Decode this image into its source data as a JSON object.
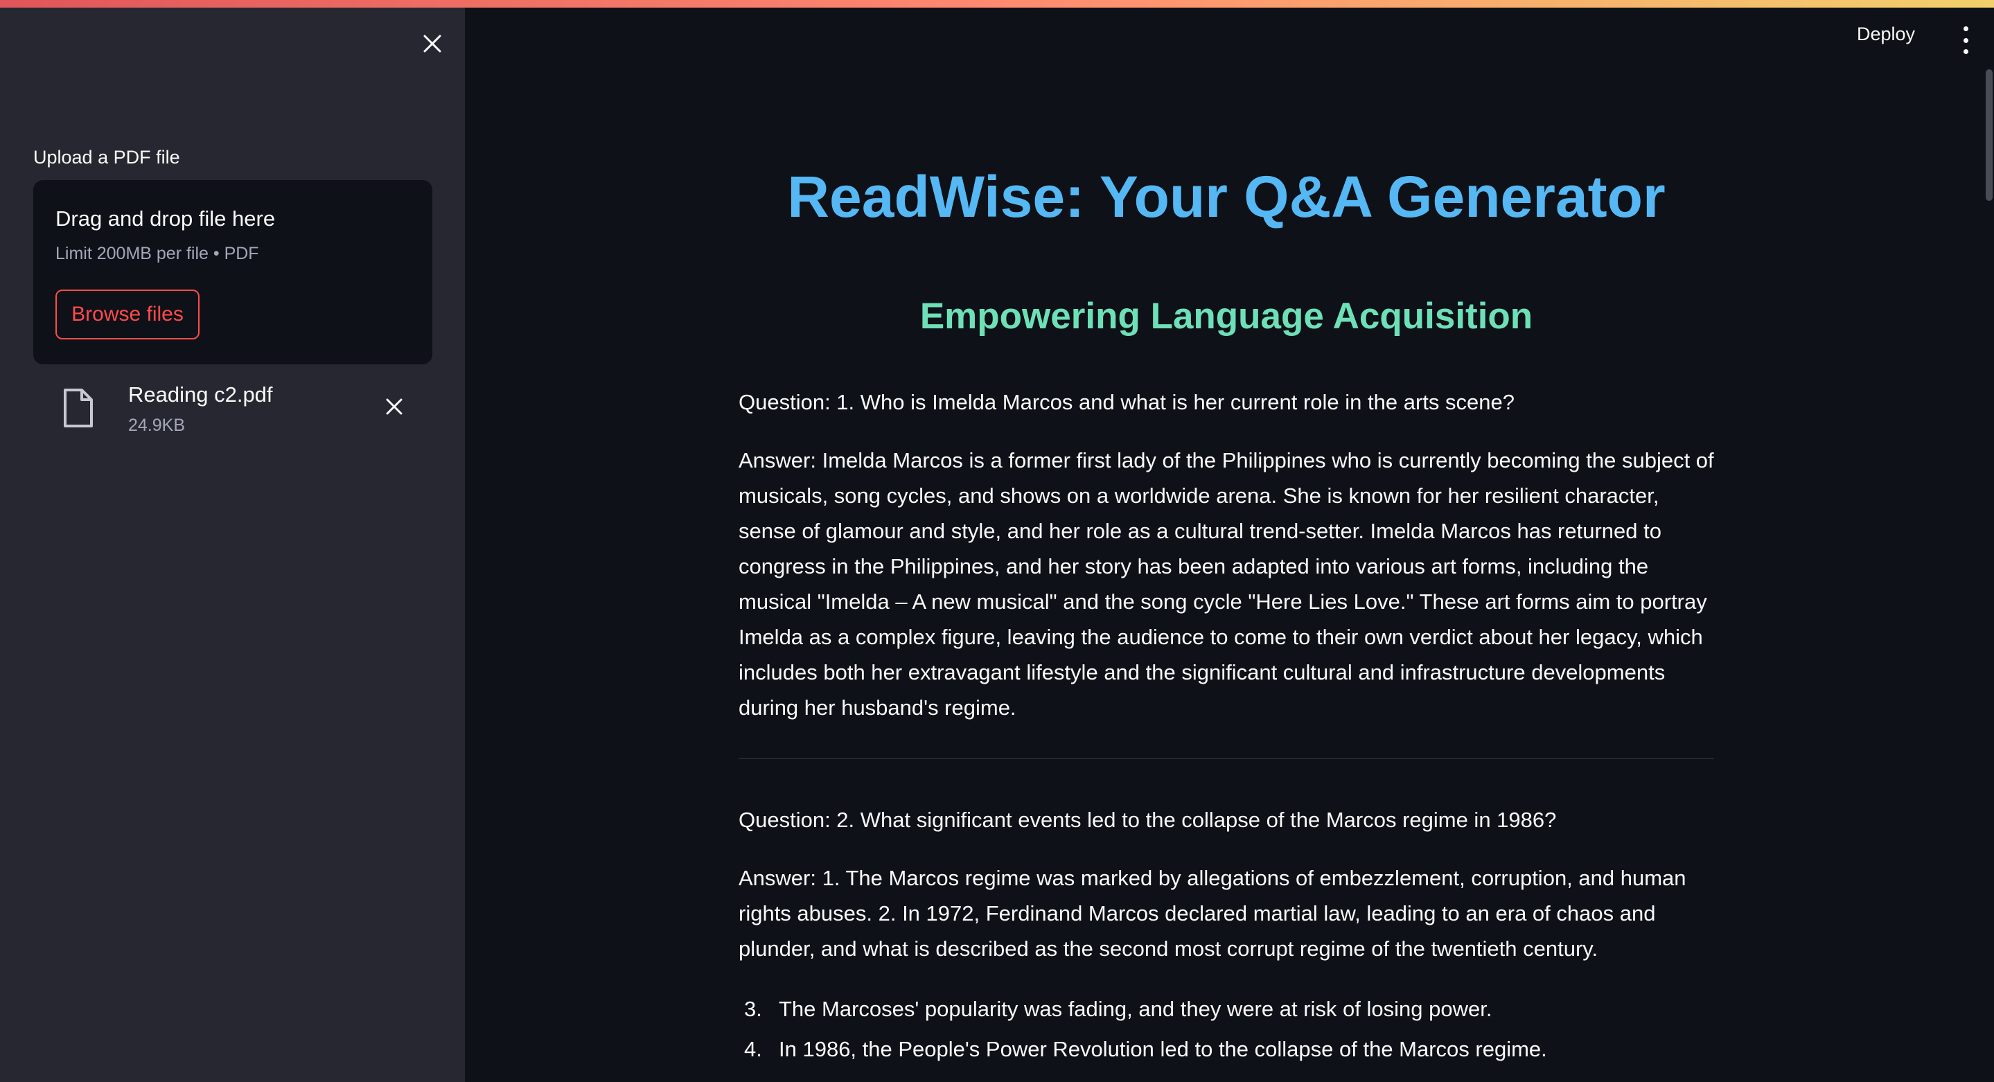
{
  "sidebar": {
    "upload_label": "Upload a PDF file",
    "dropzone": {
      "title": "Drag and drop file here",
      "limit": "Limit 200MB per file • PDF",
      "browse_label": "Browse files"
    },
    "file": {
      "name": "Reading c2.pdf",
      "size": "24.9KB"
    }
  },
  "header": {
    "deploy_label": "Deploy"
  },
  "main": {
    "title": "ReadWise: Your Q&A Generator",
    "subtitle": "Empowering Language Acquisition",
    "qa": [
      {
        "question": "Question: 1. Who is Imelda Marcos and what is her current role in the arts scene?",
        "answer": "Answer: Imelda Marcos is a former first lady of the Philippines who is currently becoming the subject of musicals, song cycles, and shows on a worldwide arena. She is known for her resilient character, sense of glamour and style, and her role as a cultural trend-setter. Imelda Marcos has returned to congress in the Philippines, and her story has been adapted into various art forms, including the musical \"Imelda – A new musical\" and the song cycle \"Here Lies Love.\" These art forms aim to portray Imelda as a complex figure, leaving the audience to come to their own verdict about her legacy, which includes both her extravagant lifestyle and the significant cultural and infrastructure developments during her husband's regime."
      },
      {
        "question": "Question: 2. What significant events led to the collapse of the Marcos regime in 1986?",
        "answer": "Answer: 1. The Marcos regime was marked by allegations of embezzlement, corruption, and human rights abuses. 2. In 1972, Ferdinand Marcos declared martial law, leading to an era of chaos and plunder, and what is described as the second most corrupt regime of the twentieth century.",
        "list": [
          {
            "num": "3.",
            "text": "The Marcoses' popularity was fading, and they were at risk of losing power."
          },
          {
            "num": "4.",
            "text": "In 1986, the People's Power Revolution led to the collapse of the Marcos regime."
          }
        ]
      }
    ]
  },
  "colors": {
    "accent": "#ff4b4b",
    "title": "#55b8f4",
    "subtitle": "#6ee0b8",
    "background": "#0e1117",
    "sidebar": "#262730"
  },
  "icons": {
    "sidebar_close": "close-icon",
    "file": "file-icon",
    "file_remove": "close-icon",
    "menu": "more-vertical-icon"
  }
}
